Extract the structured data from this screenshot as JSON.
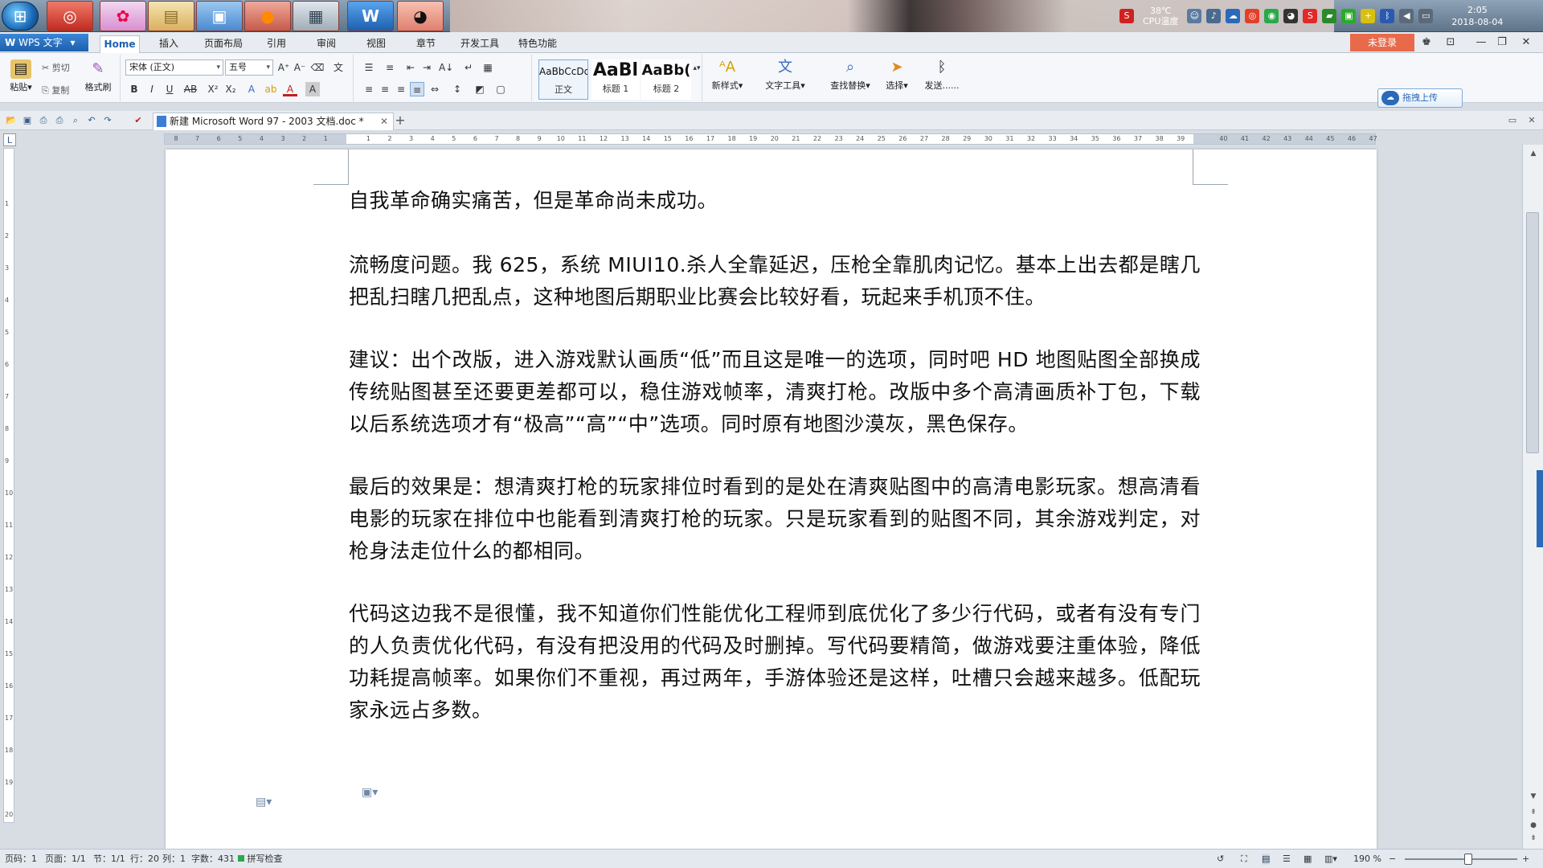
{
  "taskbar": {
    "apps": [
      "网易云音乐",
      "Picasa",
      "文件资源管理器",
      "远程桌面",
      "Firefox",
      "计算器",
      "WPS 文字",
      "QQ"
    ],
    "cpu_temp": "38℃",
    "cpu_label": "CPU温度",
    "time": "2:05",
    "date": "2018-08-04"
  },
  "app": {
    "name": "WPS 文字",
    "menu_tabs": [
      "Home",
      "插入",
      "页面布局",
      "引用",
      "审阅",
      "视图",
      "章节",
      "开发工具",
      "特色功能"
    ],
    "active_tab": "Home",
    "login_label": "未登录"
  },
  "ribbon": {
    "paste": "粘贴",
    "cut": "剪切",
    "copy": "复制",
    "format_painter": "格式刷",
    "font_name": "宋体 (正文)",
    "font_size": "五号",
    "styles": [
      {
        "preview": "AaBbCcDd",
        "label": "正文"
      },
      {
        "preview": "AaBl",
        "label": "标题 1"
      },
      {
        "preview": "AaBb(",
        "label": "标题 2"
      }
    ],
    "new_style": "新样式",
    "text_tool": "文字工具",
    "find_replace": "查找替换",
    "select": "选择",
    "send": "发送......",
    "upload": "拖拽上传"
  },
  "doc_tab": {
    "title": "新建 Microsoft Word 97 - 2003 文档.doc *"
  },
  "ruler_numbers": [
    "8",
    "7",
    "6",
    "5",
    "4",
    "3",
    "2",
    "1",
    "",
    "1",
    "2",
    "3",
    "4",
    "5",
    "6",
    "7",
    "8",
    "9",
    "10",
    "11",
    "12",
    "13",
    "14",
    "15",
    "16",
    "17",
    "18",
    "19",
    "20",
    "21",
    "22",
    "23",
    "24",
    "25",
    "26",
    "27",
    "28",
    "29",
    "30",
    "31",
    "32",
    "33",
    "34",
    "35",
    "36",
    "37",
    "38",
    "39",
    "",
    "40",
    "41",
    "42",
    "43",
    "44",
    "45",
    "46",
    "47"
  ],
  "vruler_numbers": [
    "1",
    "2",
    "3",
    "4",
    "5",
    "6",
    "7",
    "8",
    "9",
    "10",
    "11",
    "12",
    "13",
    "14",
    "15",
    "16",
    "17",
    "18",
    "19",
    "20"
  ],
  "document": {
    "paragraphs": [
      "自我革命确实痛苦，但是革命尚未成功。",
      "流畅度问题。我 625，系统 MIUI10.杀人全靠延迟，压枪全靠肌肉记忆。基本上出去都是瞎几把乱扫瞎几把乱点，这种地图后期职业比赛会比较好看，玩起来手机顶不住。",
      "建议：出个改版，进入游戏默认画质“低”而且这是唯一的选项，同时吧 HD 地图贴图全部换成传统贴图甚至还要更差都可以，稳住游戏帧率，清爽打枪。改版中多个高清画质补丁包，下载以后系统选项才有“极高”“高”“中”选项。同时原有地图沙漠灰，黑色保存。",
      "最后的效果是：想清爽打枪的玩家排位时看到的是处在清爽贴图中的高清电影玩家。想高清看电影的玩家在排位中也能看到清爽打枪的玩家。只是玩家看到的贴图不同，其余游戏判定，对枪身法走位什么的都相同。",
      "代码这边我不是很懂，我不知道你们性能优化工程师到底优化了多少行代码，或者有没有专门的人负责优化代码，有没有把没用的代码及时删掉。写代码要精简，做游戏要注重体验，降低功耗提高帧率。如果你们不重视，再过两年，手游体验还是这样，吐槽只会越来越多。低配玩家永远占多数。"
    ]
  },
  "status": {
    "page_code": "页码：1",
    "pages": "页面：1/1",
    "section": "节：1/1",
    "row": "行：20",
    "col": "列：1",
    "words": "字数：431",
    "spell": "拼写检查",
    "zoom": "190 %"
  },
  "colors": {
    "accent": "#1d5fae",
    "login": "#e86a4a",
    "page": "#ffffff",
    "workspace": "#d8dde4"
  }
}
